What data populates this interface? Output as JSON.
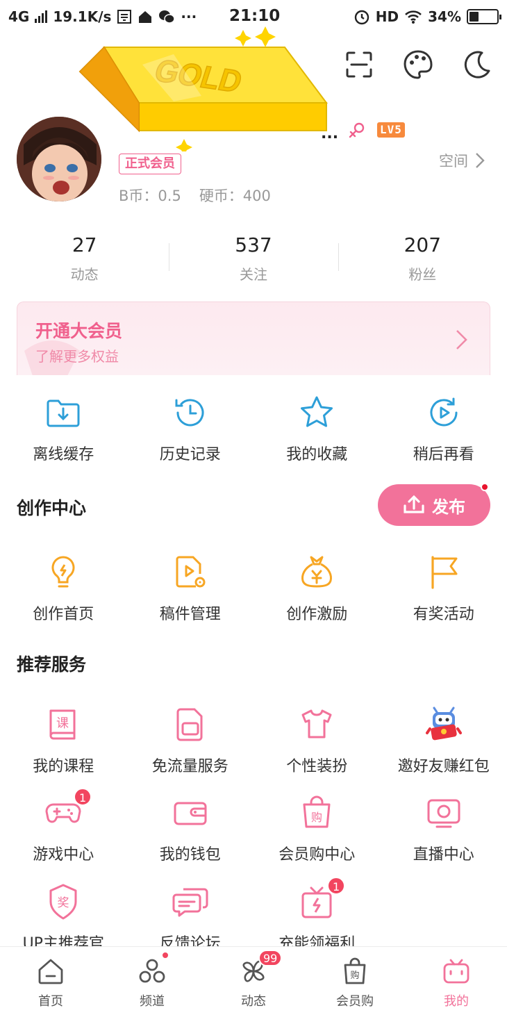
{
  "status_bar": {
    "network": "4G",
    "speed": "19.1K/s",
    "time": "21:10",
    "hd": "HD",
    "battery": "34%",
    "battery_level": 0.34
  },
  "top_actions": {
    "scan_icon": "scan-icon",
    "theme_icon": "palette-icon",
    "night_icon": "moon-icon"
  },
  "decoration": {
    "gold_text": "GOLD"
  },
  "profile": {
    "name_truncated": "...",
    "level": "LV5",
    "member_tag": "正式会员",
    "space_label": "空间",
    "b_coin": "B币：0.5",
    "hard_coin": "硬币：400"
  },
  "stats": [
    {
      "value": "27",
      "label": "动态"
    },
    {
      "value": "537",
      "label": "关注"
    },
    {
      "value": "207",
      "label": "粉丝"
    }
  ],
  "vip_banner": {
    "title": "开通大会员",
    "subtitle": "了解更多权益"
  },
  "quick_actions": [
    {
      "label": "离线缓存",
      "icon": "download-folder-icon"
    },
    {
      "label": "历史记录",
      "icon": "history-clock-icon"
    },
    {
      "label": "我的收藏",
      "icon": "star-icon"
    },
    {
      "label": "稍后再看",
      "icon": "play-later-icon"
    }
  ],
  "creation": {
    "title": "创作中心",
    "publish_label": "发布",
    "items": [
      {
        "label": "创作首页",
        "icon": "lightbulb-icon"
      },
      {
        "label": "稿件管理",
        "icon": "manuscript-icon"
      },
      {
        "label": "创作激励",
        "icon": "money-bag-icon"
      },
      {
        "label": "有奖活动",
        "icon": "flag-icon"
      }
    ]
  },
  "services": {
    "title": "推荐服务",
    "rows": [
      [
        {
          "label": "我的课程",
          "icon": "course-book-icon",
          "glyph": "课"
        },
        {
          "label": "免流量服务",
          "icon": "sim-card-icon"
        },
        {
          "label": "个性装扮",
          "icon": "tshirt-icon"
        },
        {
          "label": "邀好友赚红包",
          "icon": "robot-redpacket-icon"
        }
      ],
      [
        {
          "label": "游戏中心",
          "icon": "gamepad-icon",
          "badge": "1"
        },
        {
          "label": "我的钱包",
          "icon": "wallet-icon"
        },
        {
          "label": "会员购中心",
          "icon": "shopping-bag-icon",
          "glyph": "购"
        },
        {
          "label": "直播中心",
          "icon": "live-tv-icon"
        }
      ],
      [
        {
          "label": "UP主推荐官",
          "icon": "award-badge-icon",
          "glyph": "奖"
        },
        {
          "label": "反馈论坛",
          "icon": "chat-bubbles-icon"
        },
        {
          "label": "充能领福利",
          "icon": "gift-box-icon",
          "badge": "1"
        }
      ]
    ]
  },
  "bottom_nav": [
    {
      "label": "首页",
      "icon": "home-icon"
    },
    {
      "label": "频道",
      "icon": "channel-icon",
      "dot": true
    },
    {
      "label": "动态",
      "icon": "pinwheel-icon",
      "badge": "99"
    },
    {
      "label": "会员购",
      "icon": "shop-bag-icon",
      "glyph": "购"
    },
    {
      "label": "我的",
      "icon": "tv-mine-icon",
      "active": true
    }
  ],
  "colors": {
    "pink": "#f2729a",
    "pink_text": "#f0608d",
    "blue_icon": "#2d9fd8",
    "orange_icon": "#f7a623",
    "red_badge": "#f2455f",
    "level_orange": "#f78a3d"
  }
}
